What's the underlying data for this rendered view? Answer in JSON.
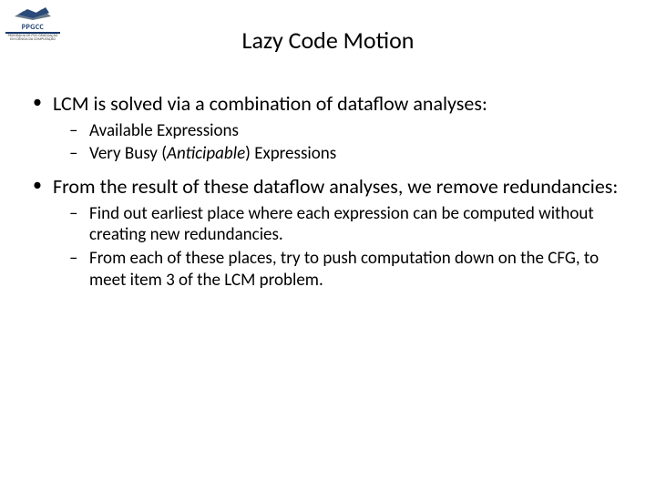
{
  "logo": {
    "line1": "PPGCC",
    "line2": "PROGRAMA DE PÓS-GRADUAÇÃO",
    "line3": "EM CIÊNCIA DA COMPUTAÇÃO"
  },
  "title": "Lazy Code Motion",
  "bullets": [
    {
      "text": "LCM is solved via a combination of dataflow analyses:",
      "sub": [
        {
          "text": "Available Expressions"
        },
        {
          "prefix": "Very Busy (",
          "ital": "Anticipable",
          "suffix": ") Expressions"
        }
      ]
    },
    {
      "text": "From the result of these dataflow analyses, we remove redundancies:",
      "sub": [
        {
          "text": "Find out earliest place where each expression can be computed without creating new redundancies."
        },
        {
          "text": "From each of these places, try to push computation down on the CFG, to meet item 3 of the LCM problem."
        }
      ]
    }
  ]
}
